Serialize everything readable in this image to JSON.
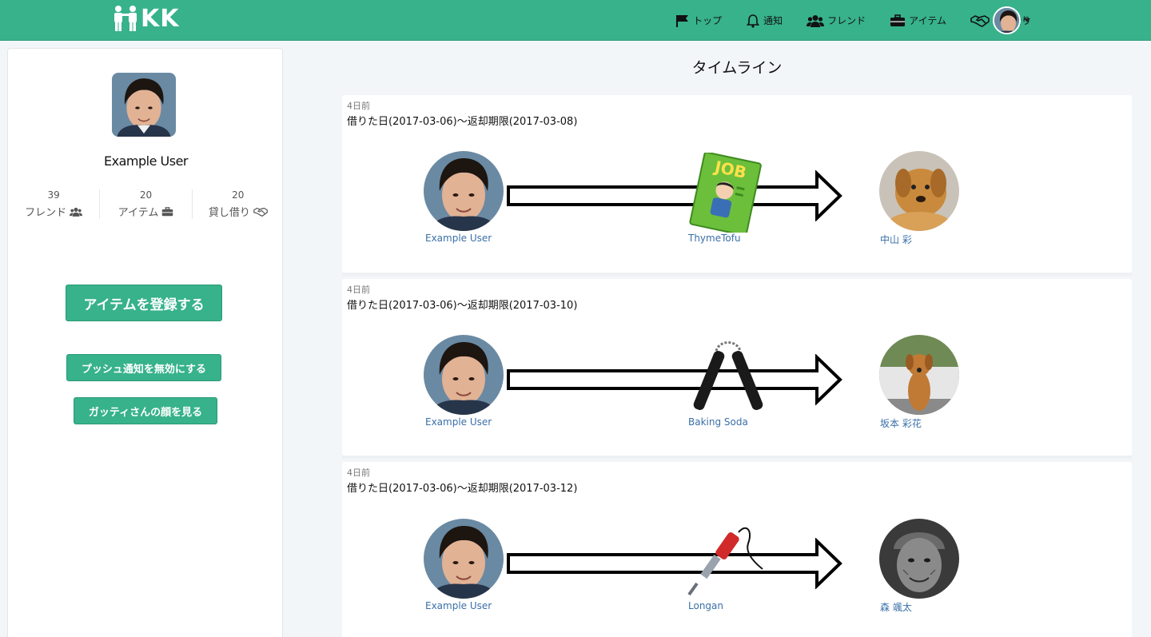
{
  "brand": {
    "logo_text": "KK"
  },
  "nav": {
    "items": [
      {
        "label": "トップ",
        "icon": "flag-icon"
      },
      {
        "label": "通知",
        "icon": "bell-icon"
      },
      {
        "label": "フレンド",
        "icon": "users-icon"
      },
      {
        "label": "アイテム",
        "icon": "briefcase-icon"
      },
      {
        "label": "貸し借り",
        "icon": "handshake-icon"
      }
    ]
  },
  "sidebar": {
    "name": "Example User",
    "stats": [
      {
        "value": "39",
        "label": "フレンド",
        "icon": "users-icon"
      },
      {
        "value": "20",
        "label": "アイテム",
        "icon": "briefcase-icon"
      },
      {
        "value": "20",
        "label": "貸し借り",
        "icon": "handshake-icon"
      }
    ],
    "register_button": "アイテムを登録する",
    "push_button": "プッシュ通知を無効にする",
    "face_button": "ガッティさんの顔を見る"
  },
  "timeline": {
    "title": "タイムライン",
    "entries": [
      {
        "time": "4日前",
        "period": "借りた日(2017-03-06)〜返却期限(2017-03-08)",
        "from": "Example User",
        "item": "ThymeTofu",
        "to": "中山 彩"
      },
      {
        "time": "4日前",
        "period": "借りた日(2017-03-06)〜返却期限(2017-03-10)",
        "from": "Example User",
        "item": "Baking Soda",
        "to": "坂本 彩花"
      },
      {
        "time": "4日前",
        "period": "借りた日(2017-03-06)〜返却期限(2017-03-12)",
        "from": "Example User",
        "item": "Longan",
        "to": "森 颯太"
      }
    ]
  },
  "colors": {
    "brand": "#37b28a",
    "link": "#3a6fa8"
  }
}
